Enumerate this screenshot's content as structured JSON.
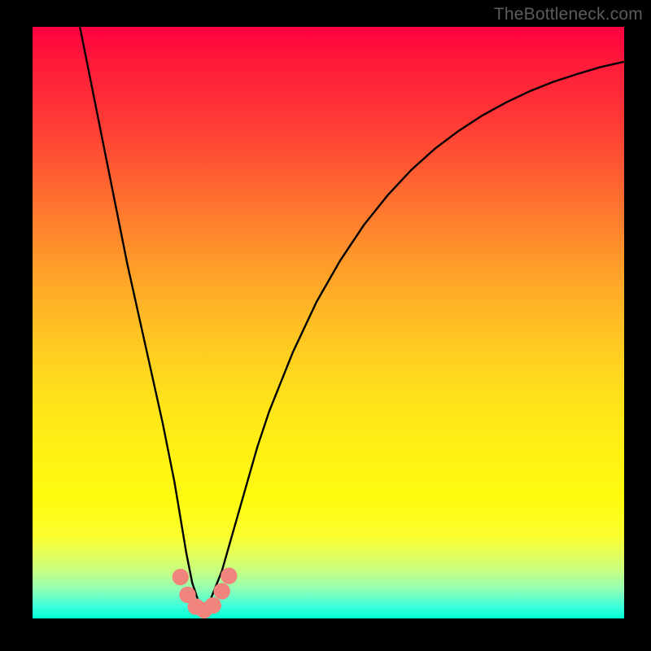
{
  "watermark": "TheBottleneck.com",
  "chart_data": {
    "type": "line",
    "title": "",
    "xlabel": "",
    "ylabel": "",
    "xlim": [
      0,
      100
    ],
    "ylim": [
      0,
      100
    ],
    "grid": false,
    "legend": false,
    "notes": "V-shaped bottleneck curve over a red-to-green vertical gradient. Values are percentage-of-plot coordinates read from the image; no axes or tick labels are visible.",
    "series": [
      {
        "name": "bottleneck-curve",
        "color": "#000000",
        "x": [
          8,
          10,
          12,
          14,
          16,
          18,
          20,
          22,
          24,
          25,
          26,
          27,
          28,
          29,
          30,
          32,
          34,
          36,
          38,
          40,
          44,
          48,
          52,
          56,
          60,
          64,
          68,
          72,
          76,
          80,
          84,
          88,
          92,
          96,
          100
        ],
        "y": [
          100,
          90,
          80,
          70,
          60,
          51,
          42,
          33,
          23,
          17,
          11,
          6,
          3,
          1.2,
          3,
          8,
          15,
          22,
          29,
          35,
          45,
          53.5,
          60.5,
          66.5,
          71.5,
          75.8,
          79.4,
          82.4,
          85,
          87.2,
          89.1,
          90.7,
          92,
          93.2,
          94.1
        ]
      }
    ],
    "markers": {
      "name": "min-region",
      "color": "#ef857d",
      "radius_pct": 1.4,
      "points": [
        {
          "x": 25.0,
          "y": 7.0
        },
        {
          "x": 26.2,
          "y": 4.0
        },
        {
          "x": 27.6,
          "y": 2.0
        },
        {
          "x": 29.0,
          "y": 1.4
        },
        {
          "x": 30.5,
          "y": 2.2
        },
        {
          "x": 32.0,
          "y": 4.6
        },
        {
          "x": 33.2,
          "y": 7.2
        }
      ]
    },
    "gradient": {
      "direction": "top-to-bottom",
      "stops": [
        {
          "pos": 0.0,
          "color": "#ff0040"
        },
        {
          "pos": 0.5,
          "color": "#ffc022"
        },
        {
          "pos": 0.8,
          "color": "#fffb0e"
        },
        {
          "pos": 1.0,
          "color": "#00ffd0"
        }
      ]
    }
  }
}
